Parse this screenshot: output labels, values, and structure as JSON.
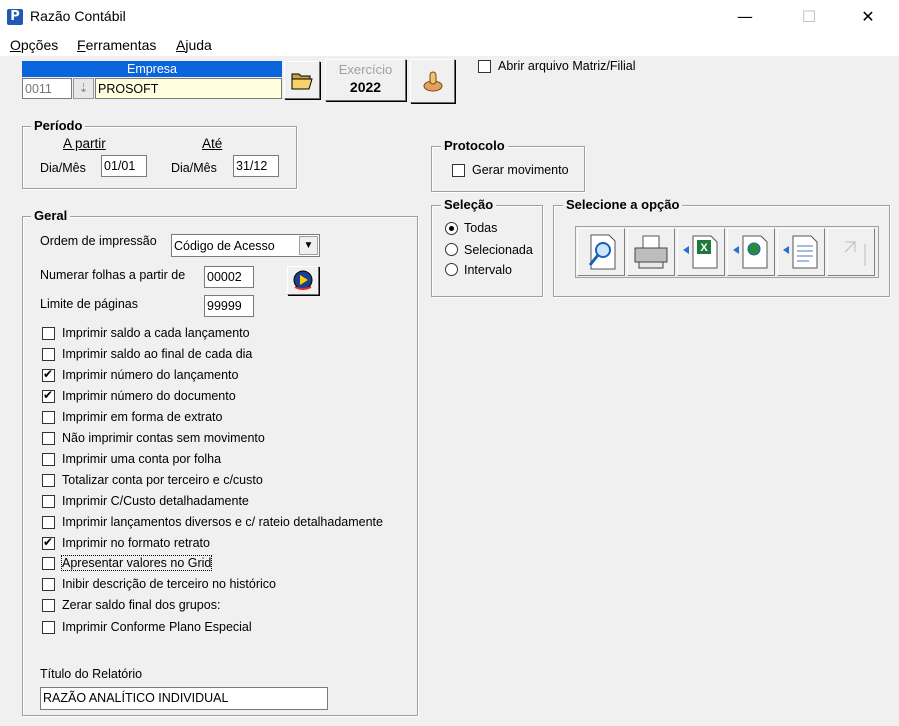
{
  "window": {
    "title": "Razão Contábil",
    "app_icon_letter": "P",
    "minimize": "—",
    "maximize": "☐",
    "close": "✕"
  },
  "menu": [
    {
      "label": "Opções",
      "hotkey": "O",
      "rest": "pções"
    },
    {
      "label": "Ferramentas",
      "hotkey": "F",
      "rest": "erramentas"
    },
    {
      "label": "Ajuda",
      "hotkey": "A",
      "rest": "juda"
    }
  ],
  "empresa": {
    "header": "Empresa",
    "code": "0011",
    "name": "PROSOFT"
  },
  "exercicio": {
    "label": "Exercício",
    "year": "2022"
  },
  "matriz_filial": {
    "label": "Abrir arquivo Matriz/Filial",
    "checked": false
  },
  "periodo": {
    "title": "Período",
    "from_header": "A partir",
    "to_header": "Até",
    "from_label": "Dia/Mês",
    "from_value": "01/01",
    "to_label": "Dia/Mês",
    "to_value": "31/12"
  },
  "protocolo": {
    "title": "Protocolo",
    "gerar_label": "Gerar movimento",
    "checked": false
  },
  "selecao": {
    "title": "Seleção",
    "options": [
      "Todas",
      "Selecionada",
      "Intervalo"
    ],
    "selected": 0
  },
  "selecione_opcao": {
    "title": "Selecione a opção",
    "buttons": [
      "preview-icon",
      "printer-icon",
      "excel-export-icon",
      "web-export-icon",
      "document-export-icon",
      "disabled-export-icon"
    ]
  },
  "geral": {
    "title": "Geral",
    "ordem_label": "Ordem de impressão",
    "ordem_value": "Código de Acesso",
    "numerar_label": "Numerar folhas a partir de",
    "numerar_value": "00002",
    "limite_label": "Limite de páginas",
    "limite_value": "99999",
    "checkboxes": [
      {
        "label": "Imprimir saldo a cada lançamento",
        "checked": false
      },
      {
        "label": "Imprimir saldo ao final de cada dia",
        "checked": false
      },
      {
        "label": "Imprimir número do lançamento",
        "checked": true
      },
      {
        "label": "Imprimir número do documento",
        "checked": true
      },
      {
        "label": "Imprimir em forma de extrato",
        "checked": false
      },
      {
        "label": "Não imprimir contas sem movimento",
        "checked": false
      },
      {
        "label": "Imprimir uma conta por folha",
        "checked": false
      },
      {
        "label": "Totalizar conta por terceiro e c/custo",
        "checked": false
      },
      {
        "label": "Imprimir C/Custo detalhadamente",
        "checked": false
      },
      {
        "label": "Imprimir lançamentos diversos e c/ rateio detalhadamente",
        "checked": false
      },
      {
        "label": "Imprimir no formato retrato",
        "checked": true
      },
      {
        "label": "Apresentar valores no Grid",
        "checked": false
      },
      {
        "label": "Inibir descrição de terceiro no histórico",
        "checked": false
      },
      {
        "label": "Zerar saldo final dos grupos:",
        "checked": false
      },
      {
        "label": "Imprimir Conforme Plano Especial",
        "checked": false
      }
    ],
    "titulo_label": "Título do Relatório",
    "titulo_value": "RAZÃO ANALÍTICO INDIVIDUAL"
  }
}
